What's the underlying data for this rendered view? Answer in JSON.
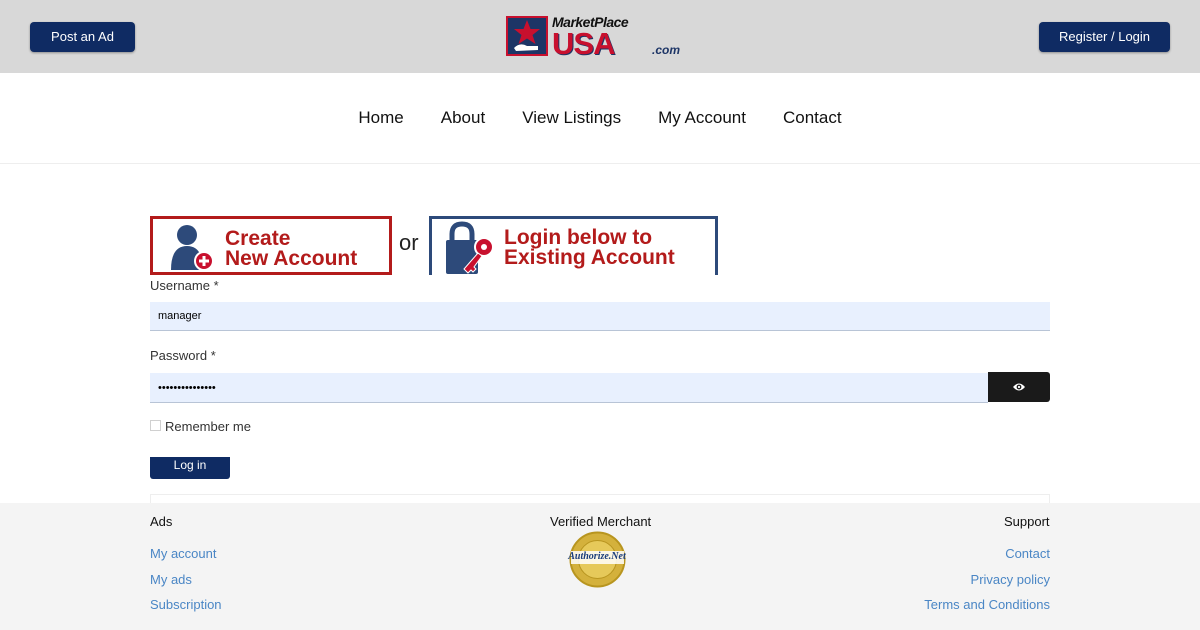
{
  "header": {
    "post_ad_label": "Post an Ad",
    "register_login_label": "Register / Login",
    "logo": {
      "top_text": "MarketPlace",
      "main_text": "USA",
      "suffix_text": ".com"
    }
  },
  "nav": {
    "items": [
      {
        "label": "Home"
      },
      {
        "label": "About"
      },
      {
        "label": "View Listings"
      },
      {
        "label": "My Account"
      },
      {
        "label": "Contact"
      }
    ]
  },
  "banners": {
    "create_line1": "Create",
    "create_line2": "New Account",
    "or_text": "or",
    "login_line1": "Login below to",
    "login_line2": "Existing Account"
  },
  "form": {
    "username_label": "Username *",
    "username_value": "manager",
    "password_label": "Password *",
    "password_value": "•••••••••••••••",
    "remember_label": "Remember me",
    "remember_checked": false,
    "login_button_label": "Log in"
  },
  "footer": {
    "ads": {
      "heading": "Ads",
      "links": [
        "My account",
        "My ads",
        "Subscription"
      ]
    },
    "verified": {
      "heading": "Verified Merchant",
      "seal_text": "Authorize.Net"
    },
    "support": {
      "heading": "Support",
      "links": [
        "Contact",
        "Privacy policy",
        "Terms and Conditions"
      ]
    }
  },
  "colors": {
    "navy": "#0f2b63",
    "brand_red": "#b31b1b",
    "link_blue": "#4a86c5",
    "field_bg": "#e8f0fe"
  }
}
